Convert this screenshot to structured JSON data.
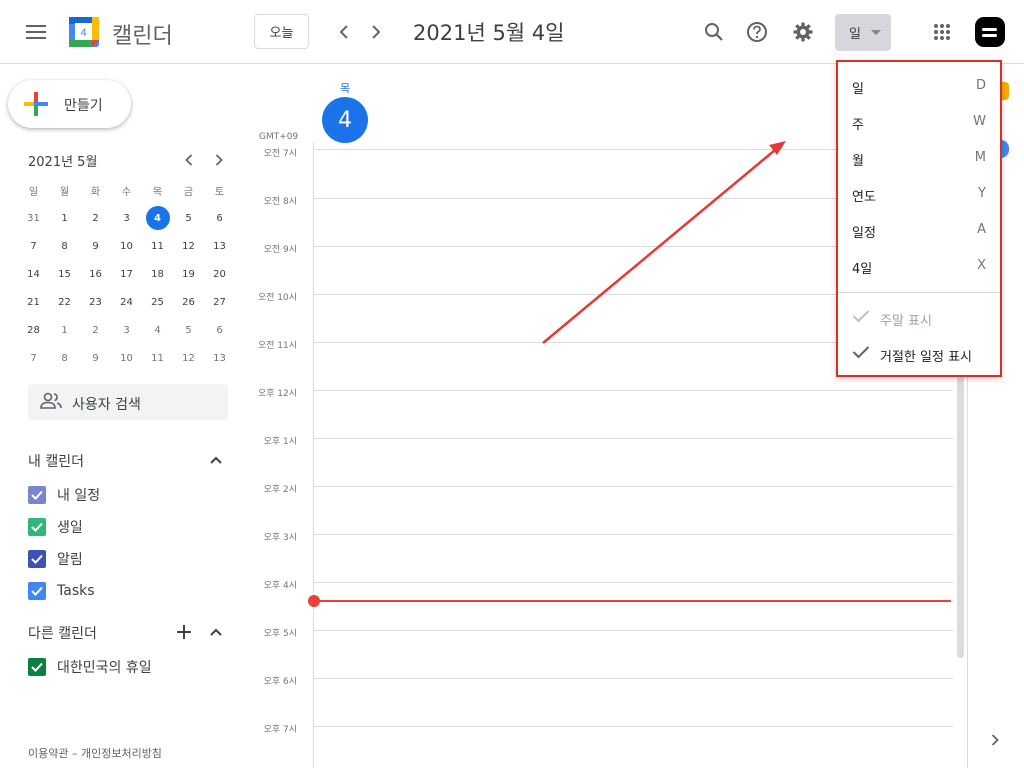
{
  "header": {
    "app_title": "캘린더",
    "logo_day": "4",
    "today_label": "오늘",
    "date_title": "2021년 5월 4일",
    "view_label": "일",
    "icons": [
      "menu-icon",
      "prev-icon",
      "next-icon",
      "search-icon",
      "help-icon",
      "settings-icon",
      "apps-icon",
      "blogger-avatar-icon"
    ]
  },
  "sidebar": {
    "create_label": "만들기",
    "mini_calendar": {
      "title": "2021년 5월",
      "weekdays": [
        "일",
        "월",
        "화",
        "수",
        "목",
        "금",
        "토"
      ],
      "weeks": [
        [
          "31",
          "1",
          "2",
          "3",
          "4",
          "5",
          "6"
        ],
        [
          "7",
          "8",
          "9",
          "10",
          "11",
          "12",
          "13"
        ],
        [
          "14",
          "15",
          "16",
          "17",
          "18",
          "19",
          "20"
        ],
        [
          "21",
          "22",
          "23",
          "24",
          "25",
          "26",
          "27"
        ],
        [
          "28",
          "1",
          "2",
          "3",
          "4",
          "5",
          "6"
        ],
        [
          "7",
          "8",
          "9",
          "10",
          "11",
          "12",
          "13"
        ]
      ],
      "selected": "4"
    },
    "search_people": "사용자 검색",
    "my_calendars_title": "내 캘린더",
    "my_calendars": [
      {
        "label": "내 일정",
        "color": "#7986cb"
      },
      {
        "label": "생일",
        "color": "#33b679"
      },
      {
        "label": "알림",
        "color": "#3f51b5"
      },
      {
        "label": "Tasks",
        "color": "#4285f4"
      }
    ],
    "other_calendars_title": "다른 캘린더",
    "other_calendars": [
      {
        "label": "대한민국의 휴일",
        "color": "#0b8043"
      }
    ],
    "footer": "이용약관 – 개인정보처리방침"
  },
  "main": {
    "day_of_week": "목",
    "day_number": "4",
    "timezone": "GMT+09",
    "hours": [
      "오전 7시",
      "오전 8시",
      "오전 9시",
      "오전 10시",
      "오전 11시",
      "오후 12시",
      "오후 1시",
      "오후 2시",
      "오후 3시",
      "오후 4시",
      "오후 5시",
      "오후 6시",
      "오후 7시"
    ]
  },
  "view_menu": {
    "items": [
      {
        "label": "일",
        "key": "D"
      },
      {
        "label": "주",
        "key": "W"
      },
      {
        "label": "월",
        "key": "M"
      },
      {
        "label": "연도",
        "key": "Y"
      },
      {
        "label": "일정",
        "key": "A"
      },
      {
        "label": "4일",
        "key": "X"
      }
    ],
    "show_weekends": "주말 표시",
    "show_declined": "거절한 일정 표시"
  },
  "colors": {
    "accent": "#1a73e8",
    "now_line": "#ea4335",
    "highlight_border": "#d93025"
  }
}
